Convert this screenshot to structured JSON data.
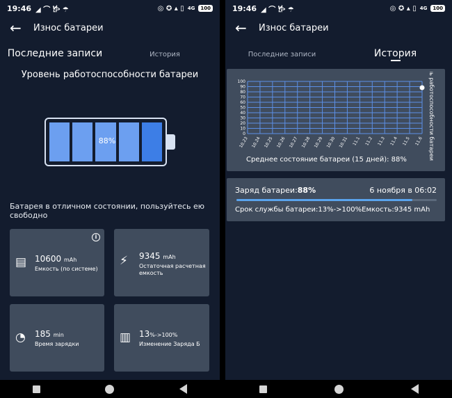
{
  "status_bar": {
    "time": "19:46",
    "left_icons": "◢ ⌒ 𐂂 ☂",
    "right_icons": "◎ ✪ ▴ ▯",
    "net": "4G",
    "battery": "100"
  },
  "left": {
    "app_title": "Износ батареи",
    "tabs": [
      "Последние записи",
      "История"
    ],
    "active_tab": 0,
    "section_title": "Уровень работоспособности батареи",
    "battery_percent": "88%",
    "battery_level": 0.88,
    "status_text": "Батарея в отличном состоянии, пользуйтесь ею свободно",
    "cards": [
      {
        "icon": "clipboard-icon",
        "glyph": "▤",
        "value": "10600",
        "unit": "mAh",
        "label": "Емкость (по системе)",
        "info": "i"
      },
      {
        "icon": "lightning-icon",
        "glyph": "⚡",
        "value": "9345",
        "unit": "mAh",
        "label": "Остаточная расчетная емкость"
      },
      {
        "icon": "speedometer-icon",
        "glyph": "◔",
        "value": "185",
        "unit": "min",
        "label": "Время зарядки"
      },
      {
        "icon": "bar-chart-icon",
        "glyph": "▥",
        "value": "13",
        "unit": "%->100%",
        "label": "Изменение Заряда Б"
      }
    ]
  },
  "right": {
    "app_title": "Износ батареи",
    "tabs": [
      "Последние записи",
      "История"
    ],
    "active_tab": 1,
    "chart_side_label": "ень работоспособности батареи",
    "chart_caption": "Среднее состояние батареи (15 дней): 88%",
    "charge_label": "Заряд батареи:",
    "charge_value": "88%",
    "charge_date": "6 ноября в 06:02",
    "charge_level": 0.88,
    "charge_detail": "Срок службы батареи:13%->100%Емкость:9345 mAh"
  },
  "chart_data": {
    "type": "line",
    "categories": [
      "10.23",
      "10.24",
      "10.25",
      "10.26",
      "10.27",
      "10.28",
      "10.29",
      "10.30",
      "10.31",
      "11.1",
      "11.2",
      "11.3",
      "11.4",
      "11.5",
      "11.6"
    ],
    "series": [
      {
        "values": [
          null,
          null,
          null,
          null,
          null,
          null,
          null,
          null,
          null,
          null,
          null,
          null,
          null,
          null,
          88
        ]
      }
    ],
    "yticks": [
      0,
      10,
      20,
      30,
      40,
      50,
      60,
      70,
      80,
      90,
      100
    ],
    "ylim": [
      0,
      100
    ],
    "grid": true,
    "colors": {
      "grid": "#5b8fe6",
      "point": "#ffffff"
    }
  }
}
